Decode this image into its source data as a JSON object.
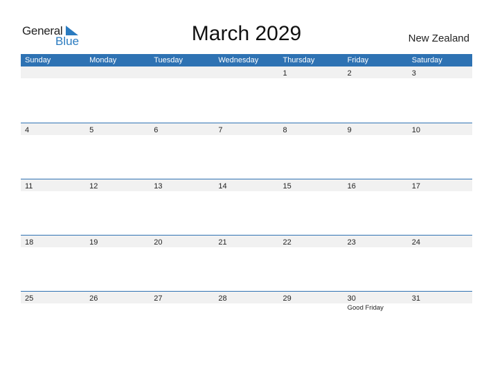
{
  "logo": {
    "line1": "General",
    "line2": "Blue"
  },
  "title": "March 2029",
  "country": "New Zealand",
  "colors": {
    "header_bg": "#2e72b3",
    "brand_blue": "#2a7bc0",
    "band_bg": "#f1f1f1"
  },
  "weekdays": [
    "Sunday",
    "Monday",
    "Tuesday",
    "Wednesday",
    "Thursday",
    "Friday",
    "Saturday"
  ],
  "weeks": [
    [
      {
        "day": ""
      },
      {
        "day": ""
      },
      {
        "day": ""
      },
      {
        "day": ""
      },
      {
        "day": "1"
      },
      {
        "day": "2"
      },
      {
        "day": "3"
      }
    ],
    [
      {
        "day": "4"
      },
      {
        "day": "5"
      },
      {
        "day": "6"
      },
      {
        "day": "7"
      },
      {
        "day": "8"
      },
      {
        "day": "9"
      },
      {
        "day": "10"
      }
    ],
    [
      {
        "day": "11"
      },
      {
        "day": "12"
      },
      {
        "day": "13"
      },
      {
        "day": "14"
      },
      {
        "day": "15"
      },
      {
        "day": "16"
      },
      {
        "day": "17"
      }
    ],
    [
      {
        "day": "18"
      },
      {
        "day": "19"
      },
      {
        "day": "20"
      },
      {
        "day": "21"
      },
      {
        "day": "22"
      },
      {
        "day": "23"
      },
      {
        "day": "24"
      }
    ],
    [
      {
        "day": "25"
      },
      {
        "day": "26"
      },
      {
        "day": "27"
      },
      {
        "day": "28"
      },
      {
        "day": "29"
      },
      {
        "day": "30",
        "holiday": "Good Friday"
      },
      {
        "day": "31"
      }
    ]
  ]
}
